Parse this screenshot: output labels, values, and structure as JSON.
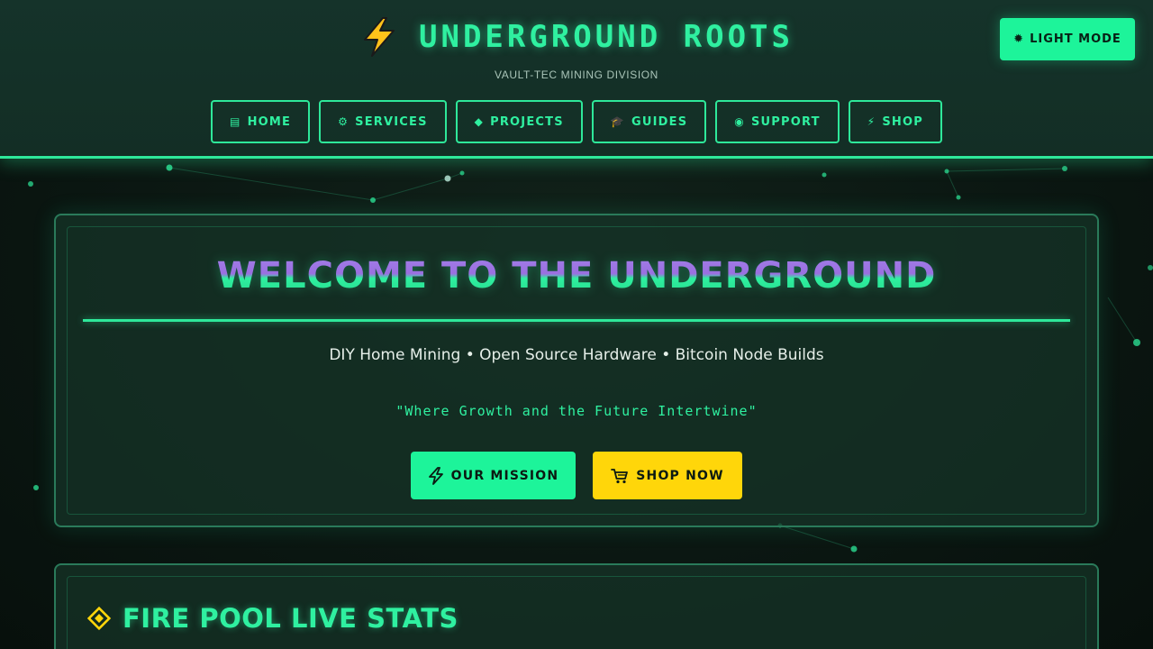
{
  "header": {
    "brand_icon": "lightning-bolt-icon",
    "title": "UNDERGROUND ROOTS",
    "subtitle": "VAULT-TEC MINING DIVISION",
    "mode_toggle": {
      "icon": "sun-icon",
      "glyph": "✹",
      "label": "LIGHT MODE"
    }
  },
  "nav": {
    "items": [
      {
        "icon": "document-icon",
        "glyph": "▤",
        "label": "HOME"
      },
      {
        "icon": "gear-icon",
        "glyph": "⚙",
        "label": "SERVICES"
      },
      {
        "icon": "diamond-icon",
        "glyph": "◆",
        "label": "PROJECTS"
      },
      {
        "icon": "graduation-cap-icon",
        "glyph": "🎓",
        "label": "GUIDES"
      },
      {
        "icon": "support-icon",
        "glyph": "◉",
        "label": "SUPPORT"
      },
      {
        "icon": "lightning-icon",
        "glyph": "⚡",
        "label": "SHOP"
      }
    ]
  },
  "hero": {
    "title": "WELCOME TO THE UNDERGROUND",
    "tagline": "DIY Home Mining • Open Source Hardware • Bitcoin Node Builds",
    "quote": "\"Where Growth and the Future Intertwine\"",
    "mission_button": {
      "icon": "lightning-icon",
      "label": "OUR MISSION"
    },
    "shop_button": {
      "icon": "cart-icon",
      "label": "SHOP NOW"
    }
  },
  "stats": {
    "icon": "diamond-icon",
    "title": "FIRE POOL LIVE STATS"
  },
  "colors": {
    "accent": "#2ff0a0",
    "button_green": "#1df49a",
    "button_yellow": "#ffd60a",
    "title_purple": "#9a6fe0",
    "background": "#0a1510",
    "panel": "#163428"
  }
}
